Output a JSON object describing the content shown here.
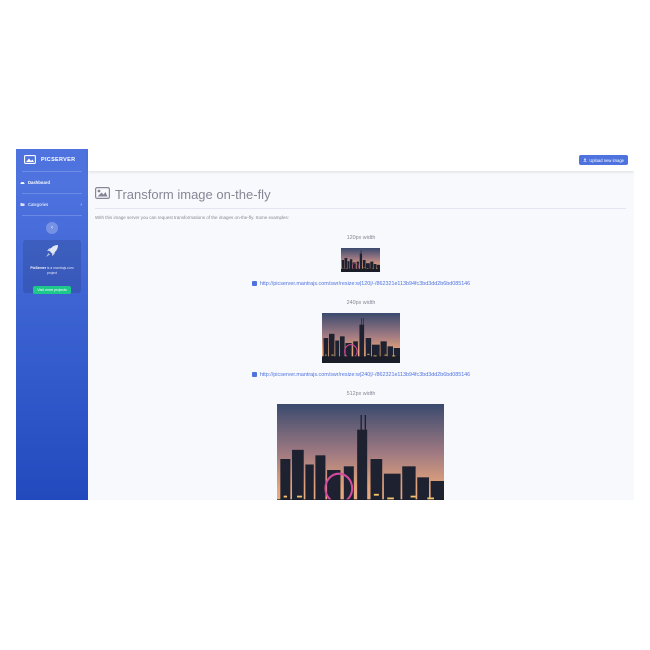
{
  "brand": {
    "name": "PICSERVER"
  },
  "sidebar": {
    "dashboard": "Dashboard",
    "categories": "Categories",
    "toggle_icon": "‹",
    "card": {
      "text_bold": "PicServer",
      "text_rest": " is a mantrajs.com project",
      "button": "Visit more projects"
    }
  },
  "topbar": {
    "upload_label": "Upload new image"
  },
  "page": {
    "title": "Transform image on-the-fly",
    "intro": "With this image server you can request transformations of the images on-the-fly. Some examples:"
  },
  "examples": [
    {
      "label": "120px width",
      "url": "http://picserver.mantrajs.com/swr/resize:w|120|/-/862321e113b94fc3bd3dd2b6bd085146"
    },
    {
      "label": "240px width",
      "url": "http://picserver.mantrajs.com/swr/resize:w|240|/-/862321e113b94fc3bd3dd2b6bd085146"
    },
    {
      "label": "512px width"
    }
  ],
  "colors": {
    "primary": "#4e73df",
    "success": "#1cc88a",
    "text_muted": "#858796"
  }
}
